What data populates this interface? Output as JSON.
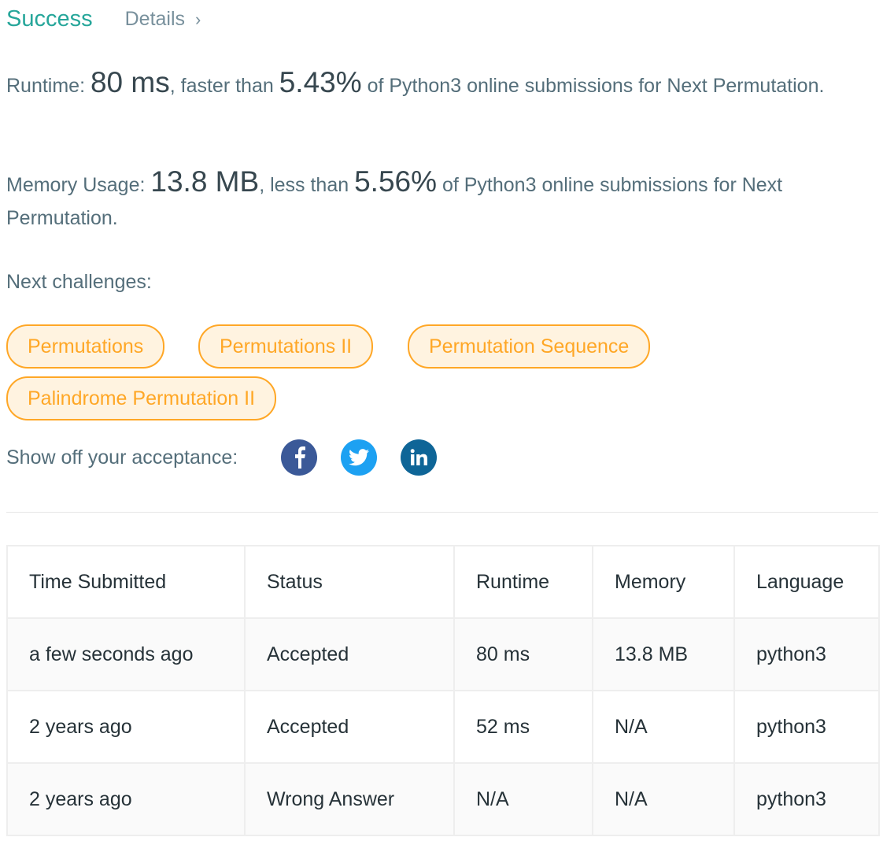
{
  "header": {
    "status": "Success",
    "details_label": "Details",
    "details_chevron": "›"
  },
  "runtime": {
    "label": "Runtime: ",
    "value": "80 ms",
    "mid": ", faster than ",
    "percent": "5.43%",
    "suffix": " of Python3 online submissions for Next Permutation."
  },
  "memory": {
    "label": "Memory Usage: ",
    "value": "13.8 MB",
    "mid": ", less than ",
    "percent": "5.56%",
    "suffix": " of Python3 online submissions for Next Permutation."
  },
  "next_challenges": {
    "label": "Next challenges:",
    "items": [
      "Permutations",
      "Permutations II",
      "Permutation Sequence",
      "Palindrome Permutation II"
    ]
  },
  "share": {
    "label": "Show off your acceptance:",
    "icons": [
      "facebook-icon",
      "twitter-icon",
      "linkedin-icon"
    ]
  },
  "colors": {
    "success": "#26a69a",
    "wrong_answer": "#d32f2f",
    "tag": "#ffa726",
    "facebook": "#3b5998",
    "twitter": "#1da1f2",
    "linkedin": "#0e6597"
  },
  "table": {
    "headers": [
      "Time Submitted",
      "Status",
      "Runtime",
      "Memory",
      "Language"
    ],
    "rows": [
      {
        "time": "a few seconds ago",
        "status": "Accepted",
        "runtime": "80 ms",
        "memory": "13.8 MB",
        "language": "python3"
      },
      {
        "time": "2 years ago",
        "status": "Accepted",
        "runtime": "52 ms",
        "memory": "N/A",
        "language": "python3"
      },
      {
        "time": "2 years ago",
        "status": "Wrong Answer",
        "runtime": "N/A",
        "memory": "N/A",
        "language": "python3"
      }
    ]
  }
}
